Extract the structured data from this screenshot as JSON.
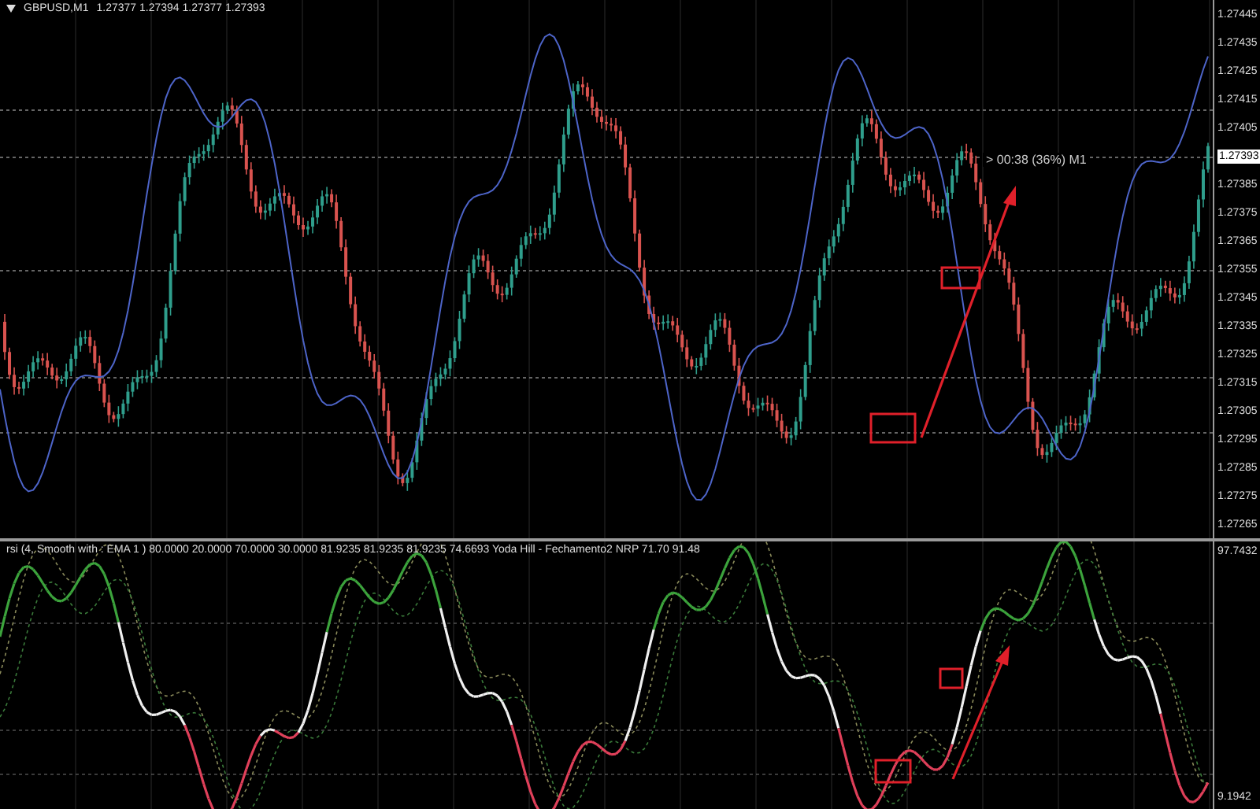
{
  "main_chart": {
    "title": "GBPUSD,M1",
    "ohlc": "1.27377 1.27394 1.27377 1.27393",
    "timer_label": "> 00:38 (36%) M1",
    "price_axis": [
      {
        "text": "1.27445",
        "kind": "tick"
      },
      {
        "text": "1.27435",
        "kind": "tick"
      },
      {
        "text": "1.27425",
        "kind": "tick"
      },
      {
        "text": "1.27415",
        "kind": "tick"
      },
      {
        "text": "1.27405",
        "kind": "tick"
      },
      {
        "text": "1.27393",
        "kind": "current"
      },
      {
        "text": "1.27385",
        "kind": "tick"
      },
      {
        "text": "1.27375",
        "kind": "tick"
      },
      {
        "text": "1.27365",
        "kind": "tick"
      },
      {
        "text": "1.27355",
        "kind": "tick"
      },
      {
        "text": "1.27345",
        "kind": "tick"
      },
      {
        "text": "1.27335",
        "kind": "tick"
      },
      {
        "text": "1.27325",
        "kind": "tick"
      },
      {
        "text": "1.27315",
        "kind": "tick"
      },
      {
        "text": "1.27305",
        "kind": "tick"
      },
      {
        "text": "1.27295",
        "kind": "tick"
      },
      {
        "text": "1.27285",
        "kind": "tick"
      },
      {
        "text": "1.27275",
        "kind": "tick"
      },
      {
        "text": "1.27265",
        "kind": "tick"
      }
    ]
  },
  "indicator_window": {
    "label": "rsi (4, Smooth with : EMA  1 ) 80.0000 20.0000 70.0000 30.0000 81.9235 81.9235 81.9235 74.6693  Yoda Hill - Fechamento2 NRP 71.70 91.48",
    "value_axis": [
      {
        "text": "97.7432"
      },
      {
        "text": "9.1942"
      }
    ]
  }
}
